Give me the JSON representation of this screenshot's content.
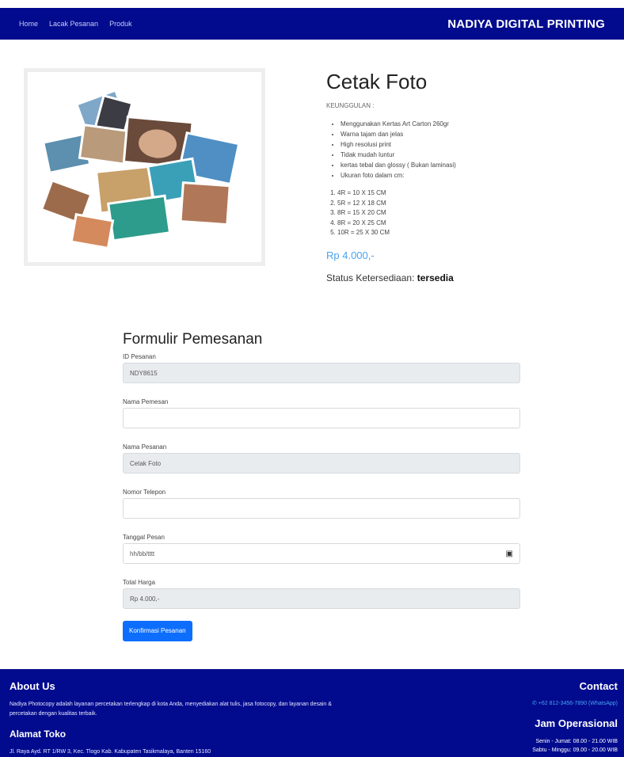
{
  "nav": {
    "links": [
      "Home",
      "Lacak Pesanan",
      "Produk"
    ],
    "brand": "NADIYA DIGITAL PRINTING"
  },
  "product": {
    "title": "Cetak Foto",
    "advantages_label": "KEUNGGULAN :",
    "advantages": [
      "Menggunakan Kertas Art Carton 260gr",
      "Warna tajam dan jelas",
      "High resolusi print",
      "Tidak mudah luntur",
      "kertas tebal dan glossy ( Bukan laminasi)",
      "Ukuran foto dalam cm:"
    ],
    "sizes": [
      "4R = 10 X 15 CM",
      "5R = 12 X 18 CM",
      "8R = 15 X 20 CM",
      "8R = 20 X 25 CM",
      "10R = 25 X 30 CM"
    ],
    "price": "Rp 4.000,-",
    "status_label": "Status Ketersediaan:",
    "status_value": "tersedia",
    "image": "photo-collage"
  },
  "form": {
    "title": "Formulir Pemesanan",
    "order_id_label": "ID Pesanan",
    "order_id_value": "NDY8615",
    "customer_label": "Nama Pemesan",
    "customer_value": "",
    "order_name_label": "Nama Pesanan",
    "order_name_value": "Cetak Foto",
    "phone_label": "Nomor Telepon",
    "phone_value": "",
    "date_label": "Tanggal Pesan",
    "date_value": "hh/bb/tttt",
    "total_label": "Total Harga",
    "total_value": "Rp 4.000,-",
    "submit_label": "Konfirmasi Pesanan"
  },
  "footer": {
    "about_title": "About Us",
    "about_text": "Nadiya Photocopy adalah layanan percetakan terlengkap di kota Anda, menyediakan alat tulis, jasa fotocopy, dan layanan desain & percetakan dengan kualitas terbaik.",
    "address_title": "Alamat Toko",
    "address_text": "Jl. Raya Ayd. RT 1/RW 3, Kec. Tlogo Kab. Kabupaten Tasikmalaya, Banten 15160",
    "contact_title": "Contact",
    "contact_text": "+62 812-3456-7890 (WhatsApp)",
    "hours_title": "Jam Operasional",
    "hours_weekday": "Senin - Jumat: 08.00 - 21.00 WIB",
    "hours_weekend": "Sabtu - Minggu: 09.00 - 20.00 WIB"
  },
  "colors": {
    "navy": "#020b8e",
    "primary": "#0d6efd",
    "price": "#4aa3f2"
  }
}
